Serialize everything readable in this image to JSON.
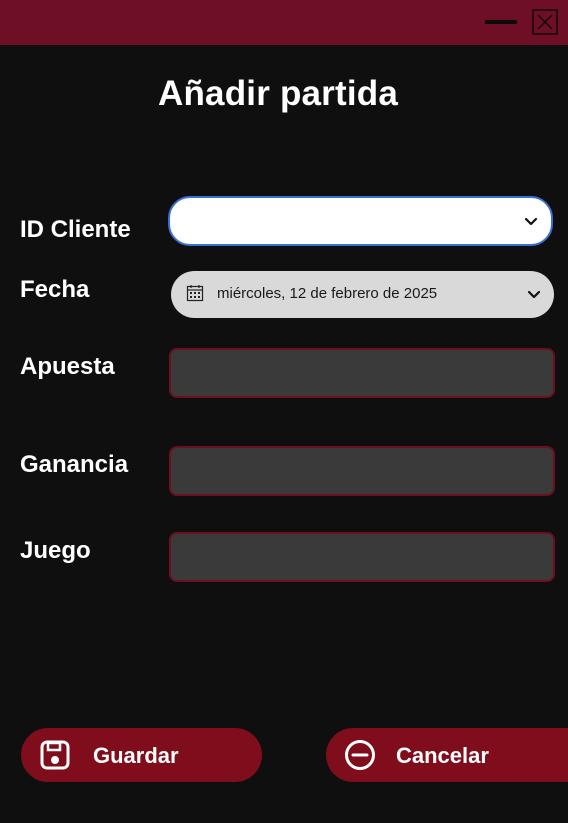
{
  "window": {
    "minimize_icon": "minimize-icon",
    "close_icon": "close-icon",
    "titlebar_color": "#6e0f25",
    "background_color": "#0f0f10"
  },
  "page": {
    "title": "Añadir partida"
  },
  "form": {
    "id_cliente": {
      "label": "ID Cliente",
      "value": "",
      "icon": "chevron-down-icon"
    },
    "fecha": {
      "label": "Fecha",
      "value": "miércoles, 12 de febrero de 2025",
      "icon": "calendar-icon"
    },
    "apuesta": {
      "label": "Apuesta",
      "value": ""
    },
    "ganancia": {
      "label": "Ganancia",
      "value": ""
    },
    "juego": {
      "label": "Juego",
      "value": ""
    }
  },
  "actions": {
    "save": {
      "label": "Guardar",
      "icon": "save-icon"
    },
    "cancel": {
      "label": "Cancelar",
      "icon": "minus-circle-icon"
    },
    "button_color": "#7f0d1c"
  },
  "colors": {
    "accent_border": "#3b6fd6",
    "input_border": "#6d0f1f",
    "input_background": "#3a3a3b"
  }
}
